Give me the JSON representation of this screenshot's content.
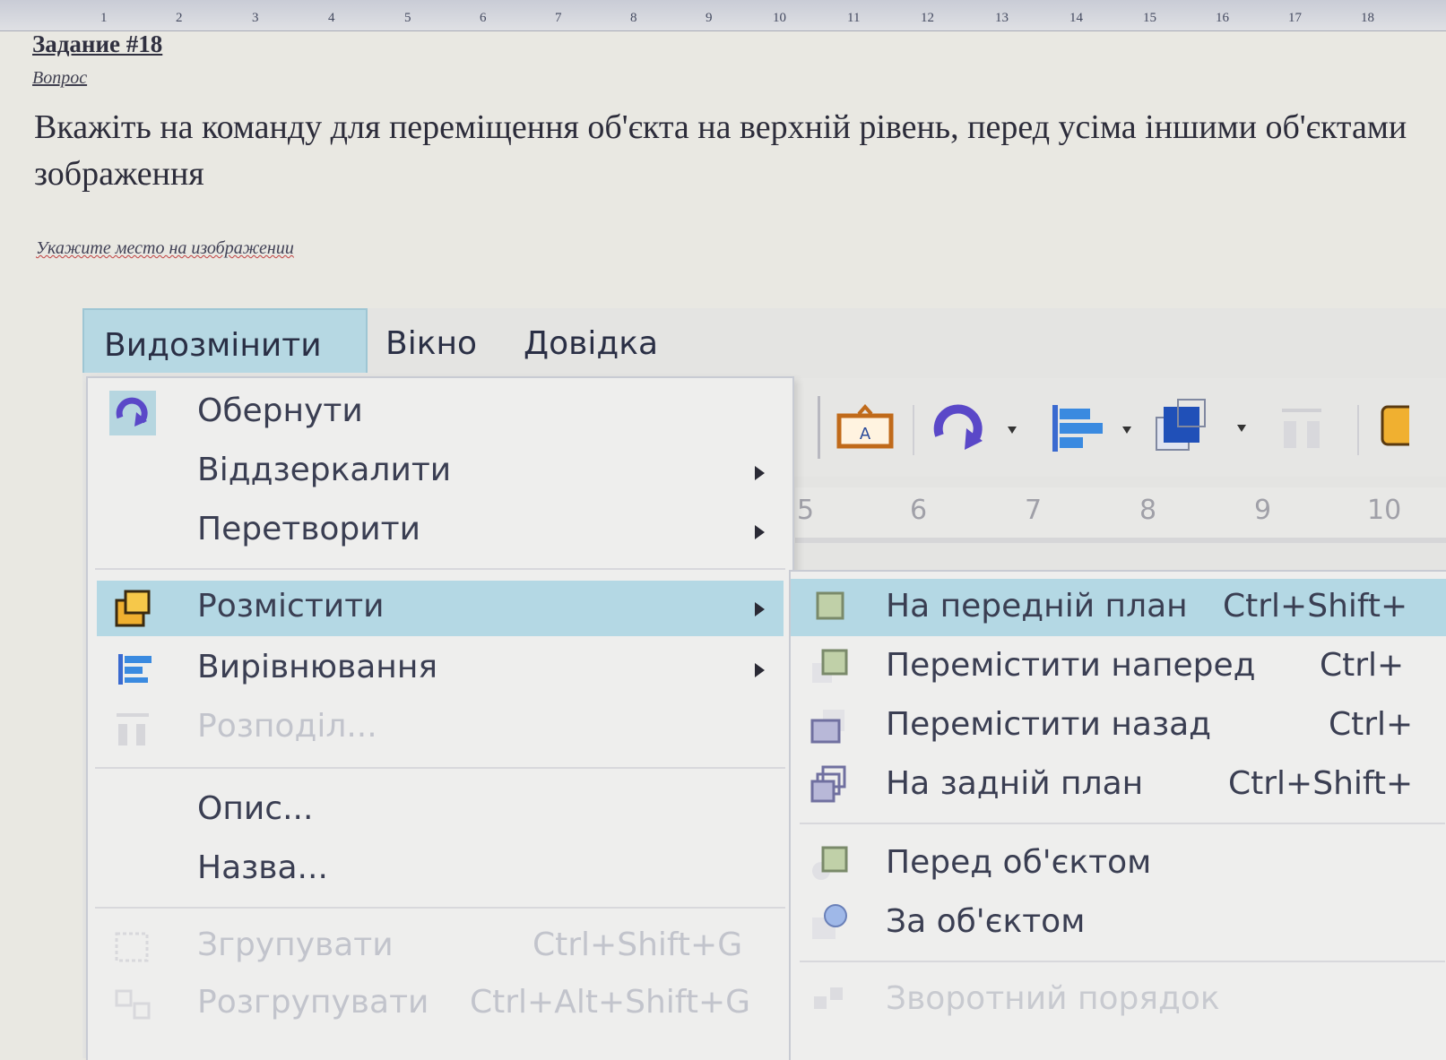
{
  "ruler": {
    "ticks": [
      "1",
      "2",
      "3",
      "4",
      "5",
      "6",
      "7",
      "8",
      "9",
      "10",
      "11",
      "12",
      "13",
      "14",
      "15",
      "16",
      "17",
      "18"
    ]
  },
  "document": {
    "task_title": "Задание #18",
    "question_label": "Вопрос",
    "question_text": "Вкажіть на команду для переміщення об'єкта на верхній рівень, перед усіма іншими об'єктами зображення",
    "hint_text": "Укажите место на изображении"
  },
  "menubar": {
    "items": [
      {
        "label": "Видозмінити",
        "active": true
      },
      {
        "label": "Вікно",
        "active": false
      },
      {
        "label": "Довідка",
        "active": false
      }
    ]
  },
  "inner_ruler": {
    "ticks": [
      "5",
      "6",
      "7",
      "8",
      "9",
      "10"
    ]
  },
  "main_menu": {
    "items": [
      {
        "label": "Обернути",
        "shortcut": "",
        "submenu": false,
        "disabled": false,
        "icon": "rotate-icon"
      },
      {
        "label": "Віддзеркалити",
        "shortcut": "",
        "submenu": true,
        "disabled": false,
        "icon": ""
      },
      {
        "label": "Перетворити",
        "shortcut": "",
        "submenu": true,
        "disabled": false,
        "icon": ""
      },
      {
        "label": "Розмістити",
        "shortcut": "",
        "submenu": true,
        "disabled": false,
        "highlighted": true,
        "icon": "arrange-icon"
      },
      {
        "label": "Вирівнювання",
        "shortcut": "",
        "submenu": true,
        "disabled": false,
        "icon": "align-icon"
      },
      {
        "label": "Розподіл...",
        "shortcut": "",
        "submenu": false,
        "disabled": true,
        "icon": "distribute-icon"
      },
      {
        "label": "Опис...",
        "shortcut": "",
        "submenu": false,
        "disabled": false,
        "icon": ""
      },
      {
        "label": "Назва...",
        "shortcut": "",
        "submenu": false,
        "disabled": false,
        "icon": ""
      },
      {
        "label": "Згрупувати",
        "shortcut": "Ctrl+Shift+G",
        "submenu": false,
        "disabled": true,
        "icon": "group-icon"
      },
      {
        "label": "Розгрупувати",
        "shortcut": "Ctrl+Alt+Shift+G",
        "submenu": false,
        "disabled": true,
        "icon": "ungroup-icon"
      }
    ]
  },
  "sub_menu": {
    "items": [
      {
        "label": "На передній план",
        "shortcut": "Ctrl+Shift+",
        "highlighted": true,
        "disabled": false,
        "icon": "bring-to-front-icon"
      },
      {
        "label": "Перемістити наперед",
        "shortcut": "Ctrl+",
        "highlighted": false,
        "disabled": false,
        "icon": "bring-forward-icon"
      },
      {
        "label": "Перемістити назад",
        "shortcut": "Ctrl+",
        "highlighted": false,
        "disabled": false,
        "icon": "send-backward-icon"
      },
      {
        "label": "На задній план",
        "shortcut": "Ctrl+Shift+",
        "highlighted": false,
        "disabled": false,
        "icon": "send-to-back-icon"
      },
      {
        "label": "Перед об'єктом",
        "shortcut": "",
        "highlighted": false,
        "disabled": false,
        "icon": "in-front-of-object-icon"
      },
      {
        "label": "За об'єктом",
        "shortcut": "",
        "highlighted": false,
        "disabled": false,
        "icon": "behind-object-icon"
      },
      {
        "label": "Зворотний порядок",
        "shortcut": "",
        "highlighted": false,
        "disabled": true,
        "icon": "reverse-order-icon"
      }
    ]
  },
  "colors": {
    "highlight": "#b4d8e4",
    "menu_bg": "#eeeeed",
    "text": "#3a3e52",
    "disabled_text": "#c2c4cc"
  }
}
